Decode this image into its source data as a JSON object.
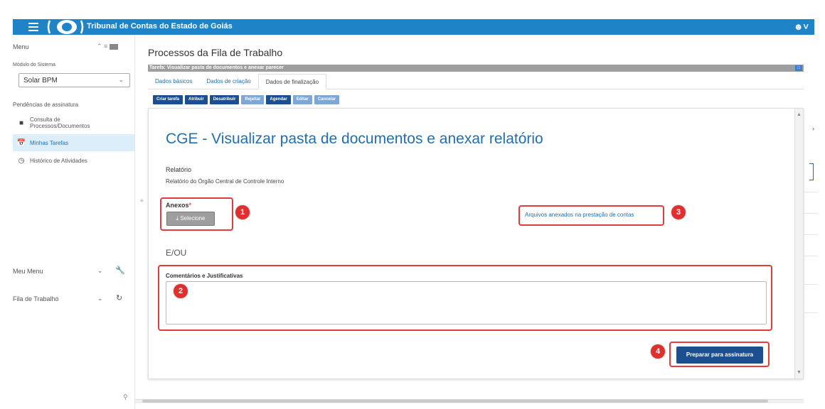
{
  "header": {
    "title": "Tribunal de Contas do Estado de Goiás",
    "user_icon": "user-icon",
    "bar_color": "#1f83c8"
  },
  "sidebar": {
    "menu_label": "Menu",
    "module_label": "Módulo do Sistema",
    "module_value": "Solar BPM",
    "section_label": "Pendências de assinatura",
    "items": [
      {
        "label": "Consulta de Processos/Documentos",
        "icon": "document-icon"
      },
      {
        "label": "Minhas Tarefas",
        "icon": "calendar-icon",
        "active": true
      },
      {
        "label": "Histórico de Atividades",
        "icon": "history-icon"
      }
    ],
    "meu_menu": "Meu Menu",
    "fila_trabalho": "Fila de Trabalho",
    "search_icon": "search-icon"
  },
  "main": {
    "page_title": "Processos da Fila de Trabalho",
    "task_bar_text": "Tarefa: Visualizar pasta de documentos e anexar parecer",
    "tabs": [
      {
        "label": "Dados básicos"
      },
      {
        "label": "Dados de criação"
      },
      {
        "label": "Dados de finalização",
        "active": true
      }
    ],
    "actions": [
      {
        "label": "Criar tarefa",
        "enabled": true
      },
      {
        "label": "Atribuir",
        "enabled": true
      },
      {
        "label": "Desatribuir",
        "enabled": true
      },
      {
        "label": "Rejeitar",
        "enabled": false
      },
      {
        "label": "Agendar",
        "enabled": true
      },
      {
        "label": "Editar",
        "enabled": false
      },
      {
        "label": "Cancelar",
        "enabled": false
      }
    ]
  },
  "form": {
    "title": "CGE - Visualizar pasta de documentos e anexar relatório",
    "relatorio_label": "Relatório",
    "relatorio_value": "Relatório do Órgão Central de Controle Interno",
    "anexos_label": "Anexos",
    "required_mark": "*",
    "select_button": "Selecione",
    "arquivos_link": "Arquivos anexados na prestação de contas",
    "or_label": "E/OU",
    "comentarios_label": "Comentários e Justificativas",
    "comentarios_value": "",
    "prepare_button": "Preparar para assinatura"
  },
  "callouts": [
    "1",
    "2",
    "3",
    "4"
  ],
  "colors": {
    "accent": "#1f6fb0",
    "callout": "#e23b3b",
    "primary_button": "#1b4f8f"
  }
}
